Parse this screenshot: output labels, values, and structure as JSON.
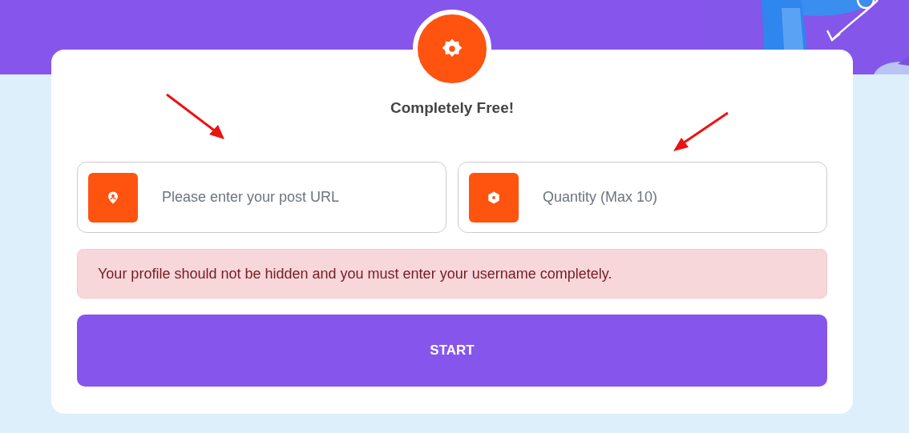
{
  "card": {
    "title": "Completely Free!",
    "fields": [
      {
        "kind": "link",
        "placeholder": "Please enter your post URL"
      },
      {
        "kind": "quantity",
        "placeholder": "Quantity (Max 10)"
      }
    ],
    "alert": "Your profile should not be hidden and you must enter your username completely.",
    "button": "START"
  }
}
